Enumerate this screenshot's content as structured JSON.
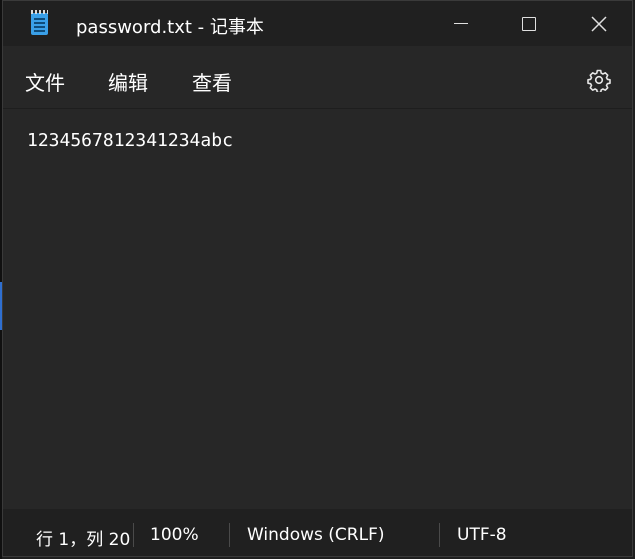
{
  "window": {
    "title": "password.txt - 记事本",
    "icons": {
      "app": "notepad-icon",
      "minimize": "minimize-icon",
      "maximize": "maximize-icon",
      "close": "close-icon",
      "settings": "gear-icon"
    },
    "close_glyph": "✕"
  },
  "menu": {
    "file": "文件",
    "edit": "编辑",
    "view": "查看"
  },
  "editor": {
    "content": "123456781234123​4abc"
  },
  "status": {
    "position": "行 1，列 20",
    "zoom": "100%",
    "line_ending": "Windows (CRLF)",
    "encoding": "UTF-8"
  },
  "colors": {
    "background": "#272727",
    "titlebar": "#202020",
    "text": "#ffffff",
    "app_icon_accent": "#3aa0e8"
  }
}
